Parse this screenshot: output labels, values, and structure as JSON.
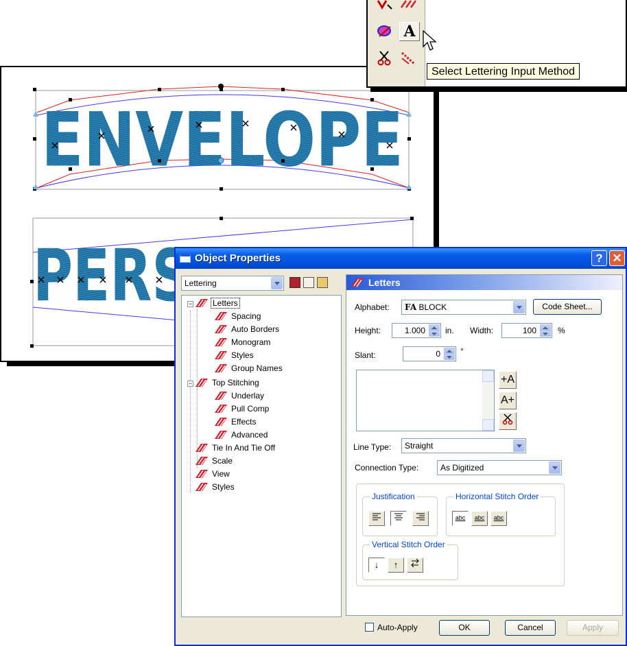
{
  "canvas": {
    "arched_text": "ENVELOPE",
    "perspective_text": "PERSPECTIVE"
  },
  "toolbar": {
    "active_button_glyph": "A",
    "tooltip": "Select Lettering Input Method"
  },
  "dialog": {
    "title": "Object Properties",
    "help_glyph": "?",
    "close_glyph": "✕",
    "category_select": "Lettering",
    "tree": [
      {
        "label": "Letters",
        "level": 0,
        "expanded": true,
        "selected": true
      },
      {
        "label": "Spacing",
        "level": 1
      },
      {
        "label": "Auto Borders",
        "level": 1
      },
      {
        "label": "Monogram",
        "level": 1
      },
      {
        "label": "Styles",
        "level": 1
      },
      {
        "label": "Group Names",
        "level": 1
      },
      {
        "label": "Top Stitching",
        "level": 0,
        "expanded": true
      },
      {
        "label": "Underlay",
        "level": 1
      },
      {
        "label": "Pull Comp",
        "level": 1
      },
      {
        "label": "Effects",
        "level": 1
      },
      {
        "label": "Advanced",
        "level": 1
      },
      {
        "label": "Tie In And Tie Off",
        "level": 0
      },
      {
        "label": "Scale",
        "level": 0
      },
      {
        "label": "View",
        "level": 0
      },
      {
        "label": "Styles",
        "level": 0
      }
    ],
    "panel": {
      "header": "Letters",
      "alphabet_label": "Alphabet:",
      "alphabet_value": "BLOCK",
      "alphabet_icon": "FA",
      "code_sheet_button": "Code Sheet...",
      "height_label": "Height:",
      "height_value": "1.000",
      "height_unit": "in.",
      "width_label": "Width:",
      "width_value": "100",
      "width_unit": "%",
      "slant_label": "Slant:",
      "slant_value": "0",
      "slant_unit": "°",
      "insert_left_glyph": "+A",
      "insert_right_glyph": "A+",
      "line_type_label": "Line Type:",
      "line_type_value": "Straight",
      "connection_type_label": "Connection Type:",
      "connection_type_value": "As Digitized",
      "justification_title": "Justification",
      "horizontal_order_title": "Horizontal Stitch Order",
      "vertical_order_title": "Vertical Stitch Order",
      "hso_labels": [
        "abc",
        "abc",
        "abc"
      ],
      "vso_down": "↓",
      "vso_up": "↑"
    },
    "footer": {
      "auto_apply_label": "Auto-Apply",
      "auto_apply_checked": false,
      "ok": "OK",
      "cancel": "Cancel",
      "apply": "Apply"
    }
  },
  "colors": {
    "stitch_blue": "#1d6fa0",
    "xp_blue": "#0054e3",
    "tree_icon_red": "#d4202a",
    "dialog_face": "#ece9d8"
  }
}
